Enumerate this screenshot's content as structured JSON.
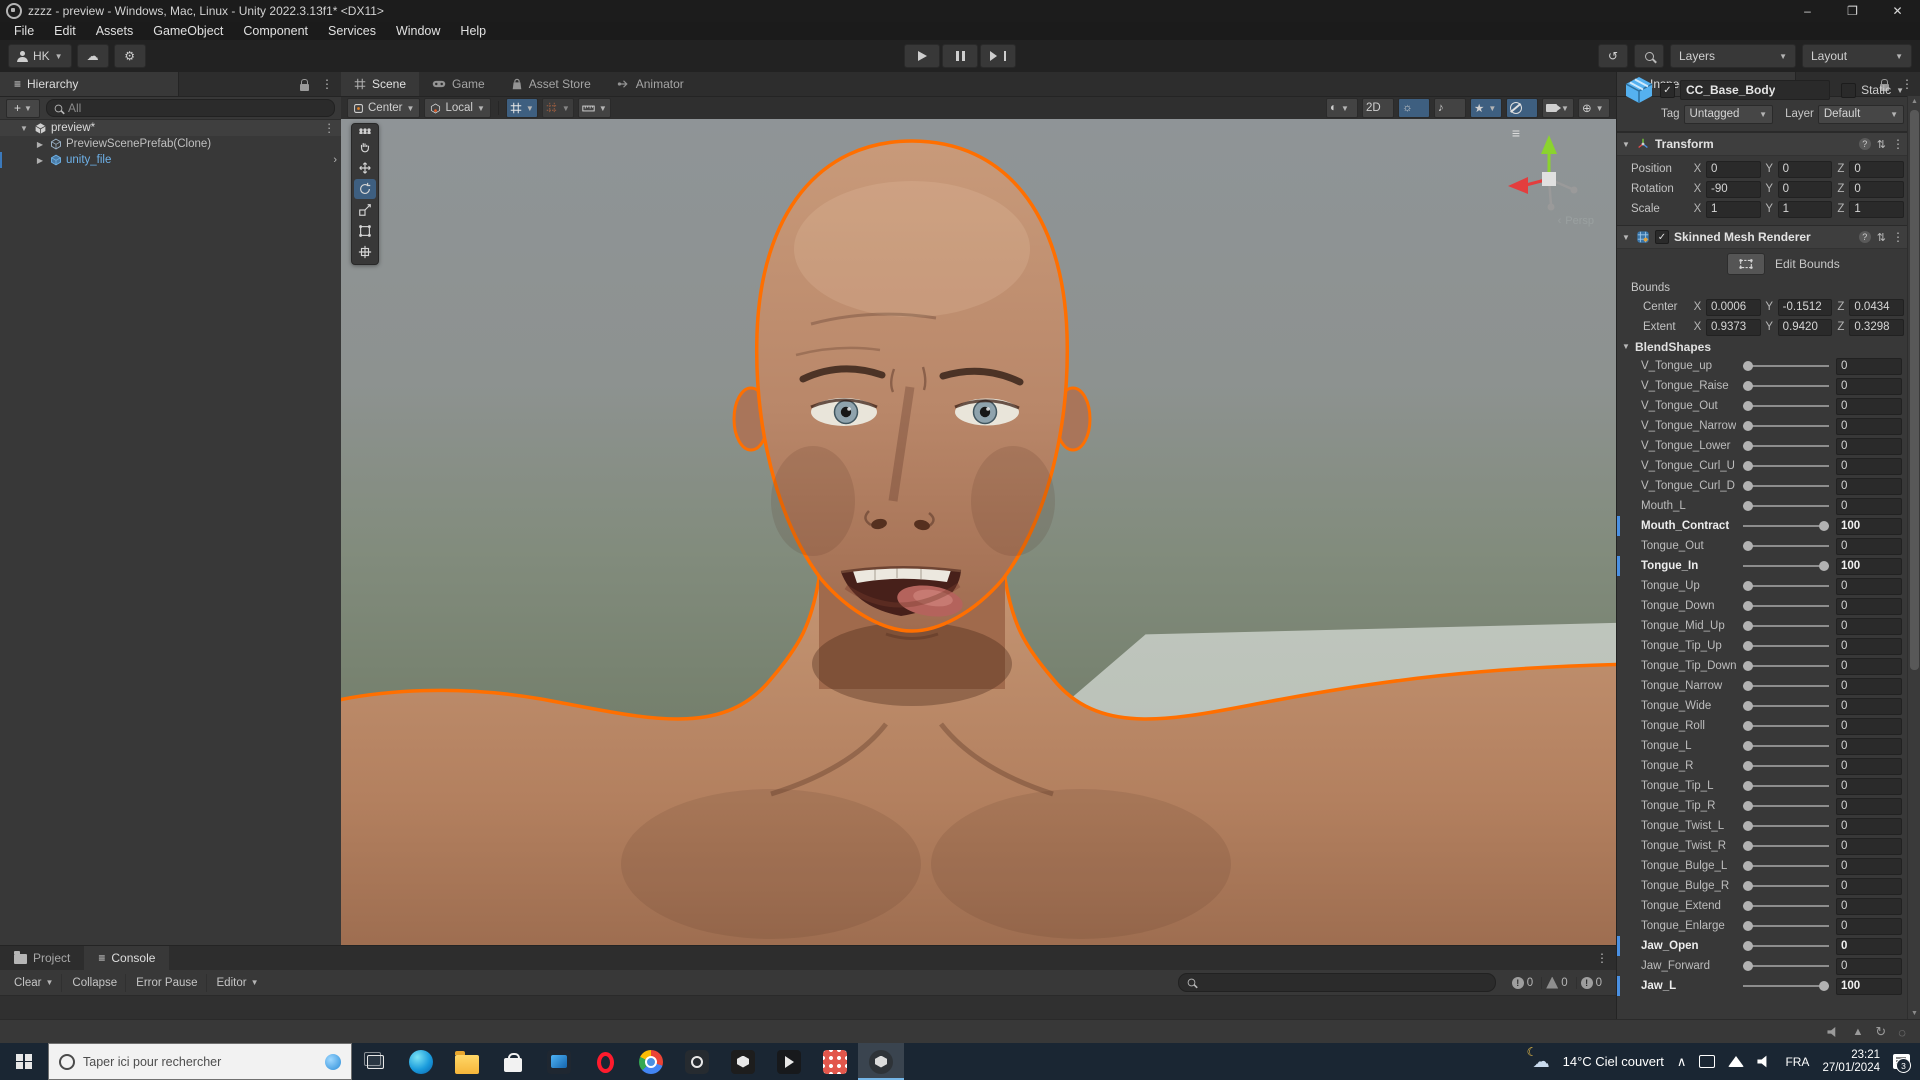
{
  "window": {
    "title": "zzzz - preview - Windows, Mac, Linux - Unity 2022.3.13f1* <DX11>",
    "controls": {
      "minimize": "–",
      "maximize": "❐",
      "close": "✕"
    }
  },
  "menu": {
    "items": [
      "File",
      "Edit",
      "Assets",
      "GameObject",
      "Component",
      "Services",
      "Window",
      "Help"
    ]
  },
  "toolbar": {
    "account": "HK",
    "layers": "Layers",
    "layout": "Layout"
  },
  "hierarchy": {
    "title": "Hierarchy",
    "filter": "All",
    "rows": [
      {
        "label": "preview*"
      },
      {
        "label": "PreviewScenePrefab(Clone)"
      },
      {
        "label": "unity_file"
      }
    ]
  },
  "scene": {
    "tabs": [
      "Scene",
      "Game",
      "Asset Store",
      "Animator"
    ],
    "pivot": "Center",
    "orientation": "Local",
    "view_2d": "2D",
    "persp": "Persp"
  },
  "inspector": {
    "title": "Inspector",
    "object_name": "CC_Base_Body",
    "static_label": "Static",
    "tag_label": "Tag",
    "tag_value": "Untagged",
    "layer_label": "Layer",
    "layer_value": "Default",
    "transform": {
      "title": "Transform",
      "axis": [
        "X",
        "Y",
        "Z"
      ],
      "rows": [
        {
          "label": "Position",
          "x": "0",
          "y": "0",
          "z": "0"
        },
        {
          "label": "Rotation",
          "x": "-90",
          "y": "0",
          "z": "0"
        },
        {
          "label": "Scale",
          "x": "1",
          "y": "1",
          "z": "1"
        }
      ]
    },
    "skinned_mesh_renderer": {
      "title": "Skinned Mesh Renderer",
      "edit_bounds": "Edit Bounds",
      "bounds_label": "Bounds",
      "center": {
        "label": "Center",
        "x": "0.0006",
        "y": "-0.1512",
        "z": "0.0434"
      },
      "extent": {
        "label": "Extent",
        "x": "0.9373",
        "y": "0.9420",
        "z": "0.3298"
      },
      "blendshapes_title": "BlendShapes",
      "blendshapes": [
        {
          "name": "V_Tongue_up",
          "value": "0"
        },
        {
          "name": "V_Tongue_Raise",
          "value": "0"
        },
        {
          "name": "V_Tongue_Out",
          "value": "0"
        },
        {
          "name": "V_Tongue_Narrow",
          "value": "0"
        },
        {
          "name": "V_Tongue_Lower",
          "value": "0"
        },
        {
          "name": "V_Tongue_Curl_U",
          "value": "0"
        },
        {
          "name": "V_Tongue_Curl_D",
          "value": "0"
        },
        {
          "name": "Mouth_L",
          "value": "0"
        },
        {
          "name": "Mouth_Contract",
          "value": "100",
          "bold": true,
          "full": true
        },
        {
          "name": "Tongue_Out",
          "value": "0"
        },
        {
          "name": "Tongue_In",
          "value": "100",
          "bold": true,
          "full": true
        },
        {
          "name": "Tongue_Up",
          "value": "0"
        },
        {
          "name": "Tongue_Down",
          "value": "0"
        },
        {
          "name": "Tongue_Mid_Up",
          "value": "0"
        },
        {
          "name": "Tongue_Tip_Up",
          "value": "0"
        },
        {
          "name": "Tongue_Tip_Down",
          "value": "0"
        },
        {
          "name": "Tongue_Narrow",
          "value": "0"
        },
        {
          "name": "Tongue_Wide",
          "value": "0"
        },
        {
          "name": "Tongue_Roll",
          "value": "0"
        },
        {
          "name": "Tongue_L",
          "value": "0"
        },
        {
          "name": "Tongue_R",
          "value": "0"
        },
        {
          "name": "Tongue_Tip_L",
          "value": "0"
        },
        {
          "name": "Tongue_Tip_R",
          "value": "0"
        },
        {
          "name": "Tongue_Twist_L",
          "value": "0"
        },
        {
          "name": "Tongue_Twist_R",
          "value": "0"
        },
        {
          "name": "Tongue_Bulge_L",
          "value": "0"
        },
        {
          "name": "Tongue_Bulge_R",
          "value": "0"
        },
        {
          "name": "Tongue_Extend",
          "value": "0"
        },
        {
          "name": "Tongue_Enlarge",
          "value": "0"
        },
        {
          "name": "Jaw_Open",
          "value": "0",
          "bold": true
        },
        {
          "name": "Jaw_Forward",
          "value": "0"
        },
        {
          "name": "Jaw_L",
          "value": "100",
          "bold": true,
          "full": true
        }
      ]
    }
  },
  "bottom": {
    "tabs": [
      "Project",
      "Console"
    ],
    "clear": "Clear",
    "collapse": "Collapse",
    "error_pause": "Error Pause",
    "editor": "Editor",
    "counters": [
      {
        "type": "info",
        "count": "0"
      },
      {
        "type": "warning",
        "count": "0"
      },
      {
        "type": "error",
        "count": "0"
      }
    ]
  },
  "taskbar": {
    "search_placeholder": "Taper ici pour rechercher",
    "weather_temp": "14°C",
    "weather_desc": "Ciel couvert",
    "language": "FRA",
    "time": "23:21",
    "date": "27/01/2024",
    "notifications": "3",
    "apps": [
      {
        "cls": "edge",
        "name": "edge"
      },
      {
        "cls": "explorer",
        "name": "file-explorer"
      },
      {
        "cls": "store",
        "name": "microsoft-store"
      },
      {
        "cls": "media",
        "name": "films-tv"
      },
      {
        "cls": "opera",
        "name": "opera"
      },
      {
        "cls": "chrome",
        "name": "chrome"
      },
      {
        "cls": "capture",
        "name": "capture-app"
      },
      {
        "cls": "hub",
        "name": "unity-hub"
      },
      {
        "cls": "darkapp",
        "name": "dark-app"
      },
      {
        "cls": "gridapp",
        "name": "grid-app"
      },
      {
        "cls": "unity",
        "name": "unity-editor",
        "active": true
      }
    ]
  },
  "colors": {
    "selection_outline": "#ff6f00",
    "active_toggle_blue": "#3e5f80",
    "prefab_text_blue": "#6eb1e8",
    "taskbar": "#1a2633",
    "panel": "#383838"
  }
}
